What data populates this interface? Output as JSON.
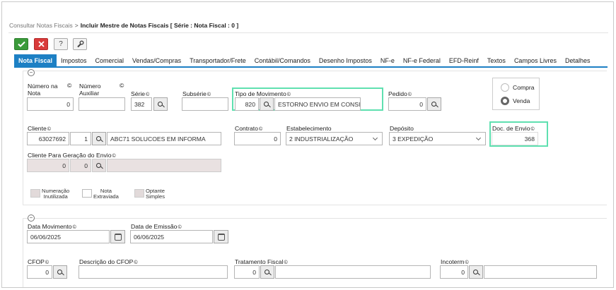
{
  "breadcrumb": {
    "parent": "Consultar Notas Fiscais",
    "separator": ">",
    "current": "Incluir Mestre de Notas Fiscais [ Série : Nota Fiscal : 0 ]"
  },
  "toolbar": {
    "confirm_icon": "check-icon",
    "cancel_icon": "close-icon",
    "help_label": "?",
    "tools_icon": "wrench-icon"
  },
  "tabs": [
    "Nota Fiscal",
    "Impostos",
    "Comercial",
    "Vendas/Compras",
    "Transportador/Frete",
    "Contábil/Comandos",
    "Desenho Impostos",
    "NF-e",
    "NF-e Federal",
    "EFD-Reinf",
    "Textos",
    "Campos Livres",
    "Detalhes"
  ],
  "form": {
    "numero_nota": {
      "label1": "Número na",
      "label2": "Nota",
      "value": "0"
    },
    "numero_auxiliar": {
      "label1": "Número",
      "label2": "Auxiliar",
      "value": ""
    },
    "serie": {
      "label": "Série",
      "value": "382"
    },
    "subserie": {
      "label": "Subsérie",
      "value": ""
    },
    "tipo_movimento": {
      "label": "Tipo de Movimento",
      "code": "820",
      "desc": "ESTORNO ENVIO EM CONSIG"
    },
    "pedido": {
      "label": "Pedido",
      "value": "0"
    },
    "compra_label": "Compra",
    "venda_label": "Venda",
    "cliente": {
      "label": "Cliente",
      "code": "63027692",
      "seq": "1",
      "name": "ABC71 SOLUCOES EM INFORMA"
    },
    "contrato": {
      "label": "Contrato",
      "value": "0"
    },
    "estabelecimento": {
      "label": "Estabelecimento",
      "value": "2 INDUSTRIALIZAÇÃO"
    },
    "deposito": {
      "label": "Depósito",
      "value": "3 EXPEDIÇÃO"
    },
    "doc_envio": {
      "label": "Doc. de Envio",
      "value": "368"
    },
    "cliente_envio": {
      "label": "Cliente Para Geração do Envio",
      "code": "0",
      "seq": "0",
      "name": ""
    },
    "checks": [
      {
        "l1": "Numeração",
        "l2": "Inutilizada"
      },
      {
        "l1": "Nota",
        "l2": "Extraviada"
      },
      {
        "l1": "Optante",
        "l2": "Simples"
      }
    ]
  },
  "section2": {
    "data_movimento": {
      "label": "Data Movimento",
      "value": "06/06/2025"
    },
    "data_emissao": {
      "label": "Data de Emissão",
      "value": "06/06/2025"
    },
    "cfop": {
      "label": "CFOP",
      "value": "0"
    },
    "desc_cfop": {
      "label": "Descrição do CFOP",
      "value": ""
    },
    "tratamento_fiscal": {
      "label": "Tratamento Fiscal",
      "value": "0"
    },
    "incoterm": {
      "label": "Incoterm",
      "value": "0"
    }
  },
  "colors": {
    "tab_active": "#1d80c4",
    "confirm": "#3a9a3a",
    "cancel": "#d93a3a",
    "highlight": "#5fe0b0"
  }
}
